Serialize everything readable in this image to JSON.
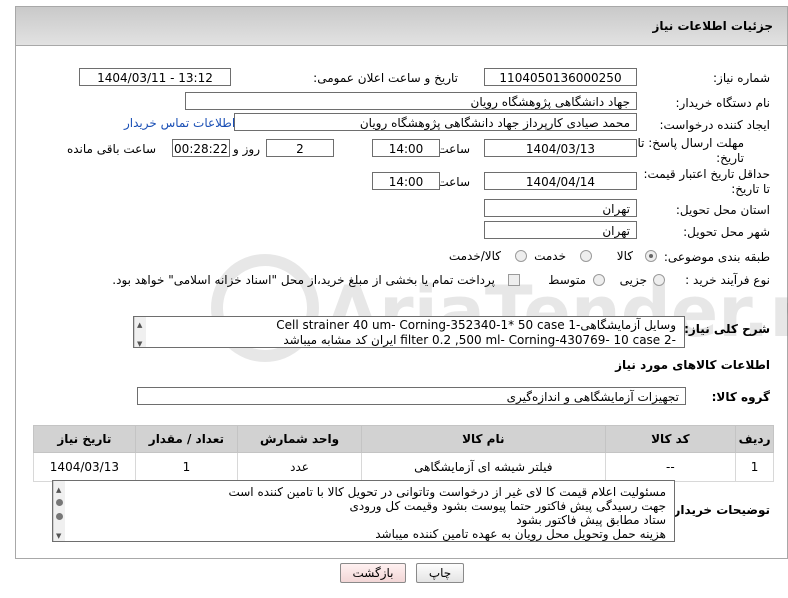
{
  "header": {
    "title": "جزئیات اطلاعات نیاز"
  },
  "fields": {
    "need_number_label": "شماره نیاز:",
    "need_number": "1104050136000250",
    "announce_label": "تاریخ و ساعت اعلان عمومی:",
    "announce_value": "1404/03/11 - 13:12",
    "buyer_org_label": "نام دستگاه خریدار:",
    "buyer_org": "جهاد دانشگاهی پژوهشگاه رویان",
    "requester_label": "ایجاد کننده درخواست:",
    "requester": "محمد صیادی کارپرداز جهاد دانشگاهی پژوهشگاه رویان",
    "contact_link": "اطلاعات تماس خریدار",
    "deadline_label_1": "مهلت ارسال پاسخ: تا",
    "deadline_label_2": "تاریخ:",
    "deadline_date": "1404/03/13",
    "time_word": "ساعت",
    "deadline_time": "14:00",
    "days_value": "2",
    "days_word": "روز و",
    "remaining_time": "00:28:22",
    "remaining_word": "ساعت باقی مانده",
    "validity_label_1": "حداقل تاریخ اعتبار قیمت:",
    "validity_label_2": "تا تاریخ:",
    "validity_date": "1404/04/14",
    "validity_time": "14:00",
    "province_label": "استان محل تحویل:",
    "province": "تهران",
    "city_label": "شهر محل تحویل:",
    "city": "تهران",
    "category_label": "طبقه بندی موضوعی:",
    "category_options": [
      "کالا",
      "خدمت",
      "کالا/خدمت"
    ],
    "process_label": "نوع فرآیند خرید :",
    "process_options": [
      "جزیی",
      "متوسط"
    ],
    "payment_note": "پرداخت تمام یا بخشی از مبلغ خرید،از محل \"اسناد خزانه اسلامی\" خواهد بود."
  },
  "description": {
    "label": "شرح کلی نیاز:",
    "line1": "وسایل آزمایشگاهی-1 Cell strainer 40 um- Corning-352340-1* 50 case",
    "line2": "-2 filter 0.2 ,500 ml- Corning-430769- 10 case ایران کد مشابه میباشد"
  },
  "goods_info_title": "اطلاعات کالاهای مورد نیاز",
  "goods_group": {
    "label": "گروه کالا:",
    "value": "تجهیزات آزمایشگاهی و اندازه‌گیری"
  },
  "table": {
    "headers": [
      "ردیف",
      "کد کالا",
      "نام کالا",
      "واحد شمارش",
      "تعداد / مقدار",
      "تاریخ نیاز"
    ],
    "rows": [
      [
        "1",
        "--",
        "فیلتر شیشه ای آزمایشگاهی",
        "عدد",
        "1",
        "1404/03/13"
      ]
    ]
  },
  "buyer_notes": {
    "label": "توضیحات خریدار:",
    "lines": [
      "مسئولیت اعلام قیمت کا لای  غیر از درخواست وتاتوانی در تحویل کالا با تامین کننده است",
      "جهت رسیدگی پیش فاکتور حتما پیوست بشود وقیمت کل ورودی",
      "ستاد مطابق پیش فاکتور بشود",
      "هزینه حمل وتحویل محل رویان به عهده تامین کننده میباشد"
    ]
  },
  "buttons": {
    "print": "چاپ",
    "back": "بازگشت"
  },
  "watermark_text": "AriaTender.neT"
}
